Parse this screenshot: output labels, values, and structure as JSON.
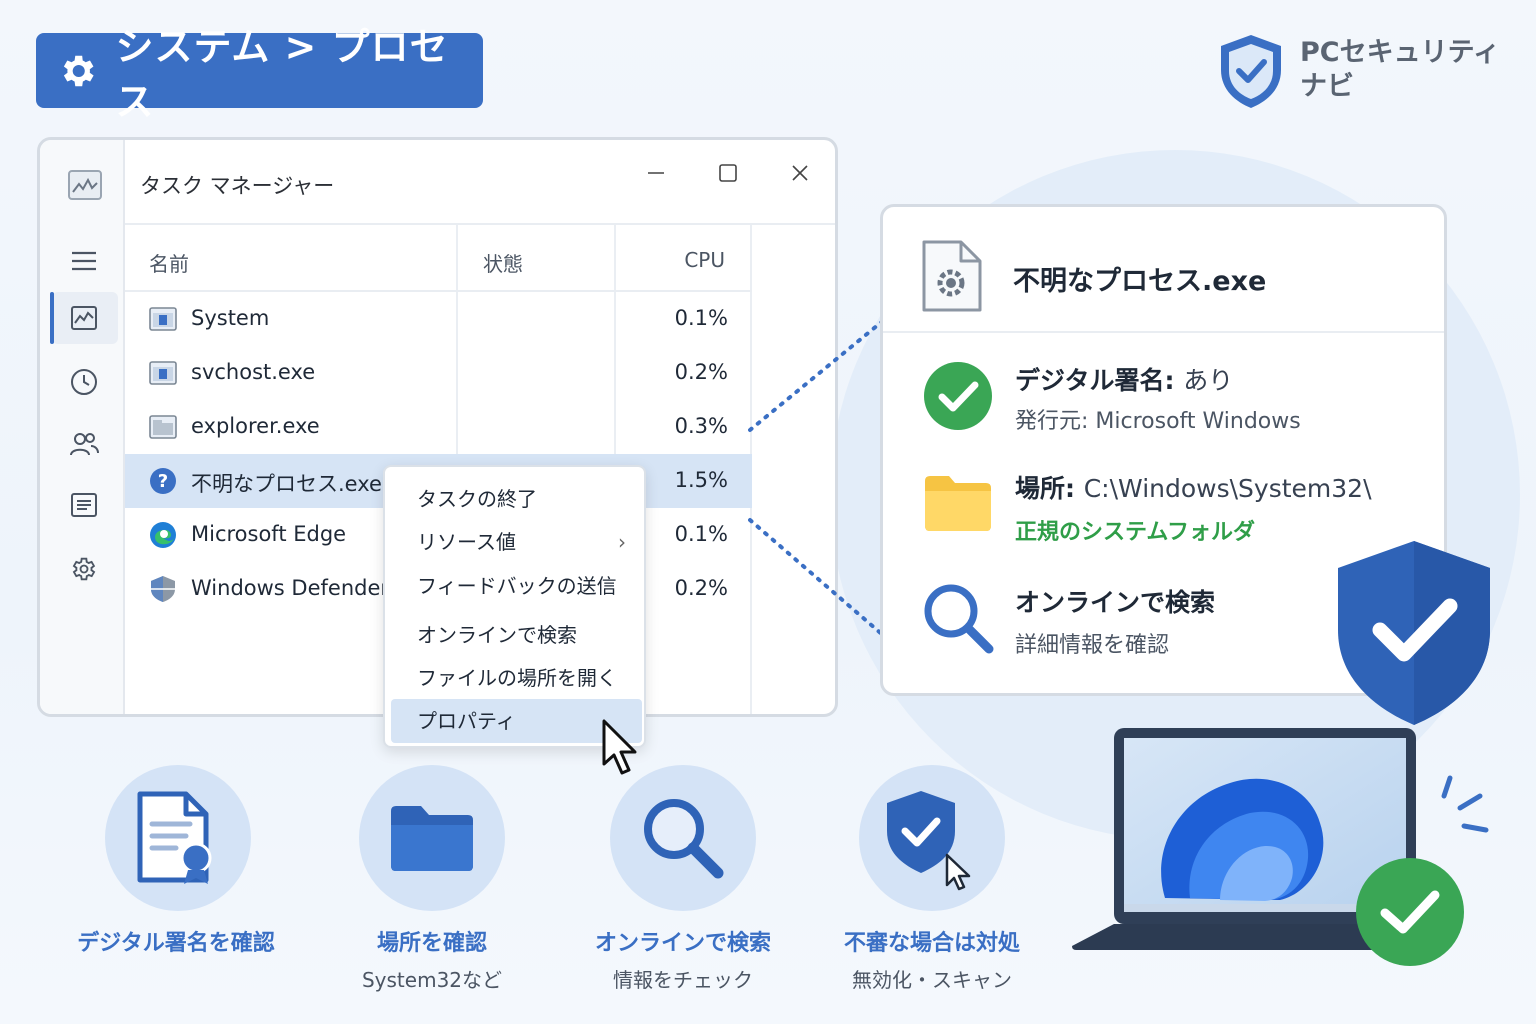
{
  "header": {
    "title": "システム > プロセス"
  },
  "brand": {
    "line1": "PCセキュリティ",
    "line2": "ナビ"
  },
  "task_manager": {
    "title": "タスク マネージャー",
    "columns": {
      "name": "名前",
      "status": "状態",
      "cpu": "CPU"
    },
    "rows": [
      {
        "name": "System",
        "cpu": "0.1%",
        "icon": "window-icon"
      },
      {
        "name": "svchost.exe",
        "cpu": "0.2%",
        "icon": "window-icon"
      },
      {
        "name": "explorer.exe",
        "cpu": "0.3%",
        "icon": "folder-window-icon"
      },
      {
        "name": "不明なプロセス.exe",
        "cpu": "1.5%",
        "icon": "question-icon",
        "selected": true
      },
      {
        "name": "Microsoft Edge",
        "cpu": "0.1%",
        "icon": "edge-icon"
      },
      {
        "name": "Windows Defender",
        "cpu": "0.2%",
        "icon": "defender-icon"
      }
    ]
  },
  "context_menu": {
    "items": [
      {
        "label": "タスクの終了"
      },
      {
        "label": "リソース値",
        "submenu": true
      },
      {
        "label": "フィードバックの送信"
      },
      {
        "label": "オンラインで検索"
      },
      {
        "label": "ファイルの場所を開く"
      },
      {
        "label": "プロパティ",
        "highlighted": true
      }
    ]
  },
  "detail": {
    "title": "不明なプロセス.exe",
    "signature": {
      "label": "デジタル署名:",
      "value": "あり",
      "publisher": "発行元: Microsoft Windows"
    },
    "location": {
      "label": "場所:",
      "value": "C:\\Windows\\System32\\",
      "note": "正規のシステムフォルダ"
    },
    "search": {
      "label": "オンラインで検索",
      "sub": "詳細情報を確認"
    }
  },
  "features": [
    {
      "label": "デジタル署名を確認",
      "sub": ""
    },
    {
      "label": "場所を確認",
      "sub": "System32など"
    },
    {
      "label": "オンラインで検索",
      "sub": "情報をチェック"
    },
    {
      "label": "不審な場合は対処",
      "sub": "無効化・スキャン"
    }
  ],
  "colors": {
    "accent": "#3a6fc4",
    "success": "#3aa655",
    "highlight": "#d6e4f5"
  }
}
